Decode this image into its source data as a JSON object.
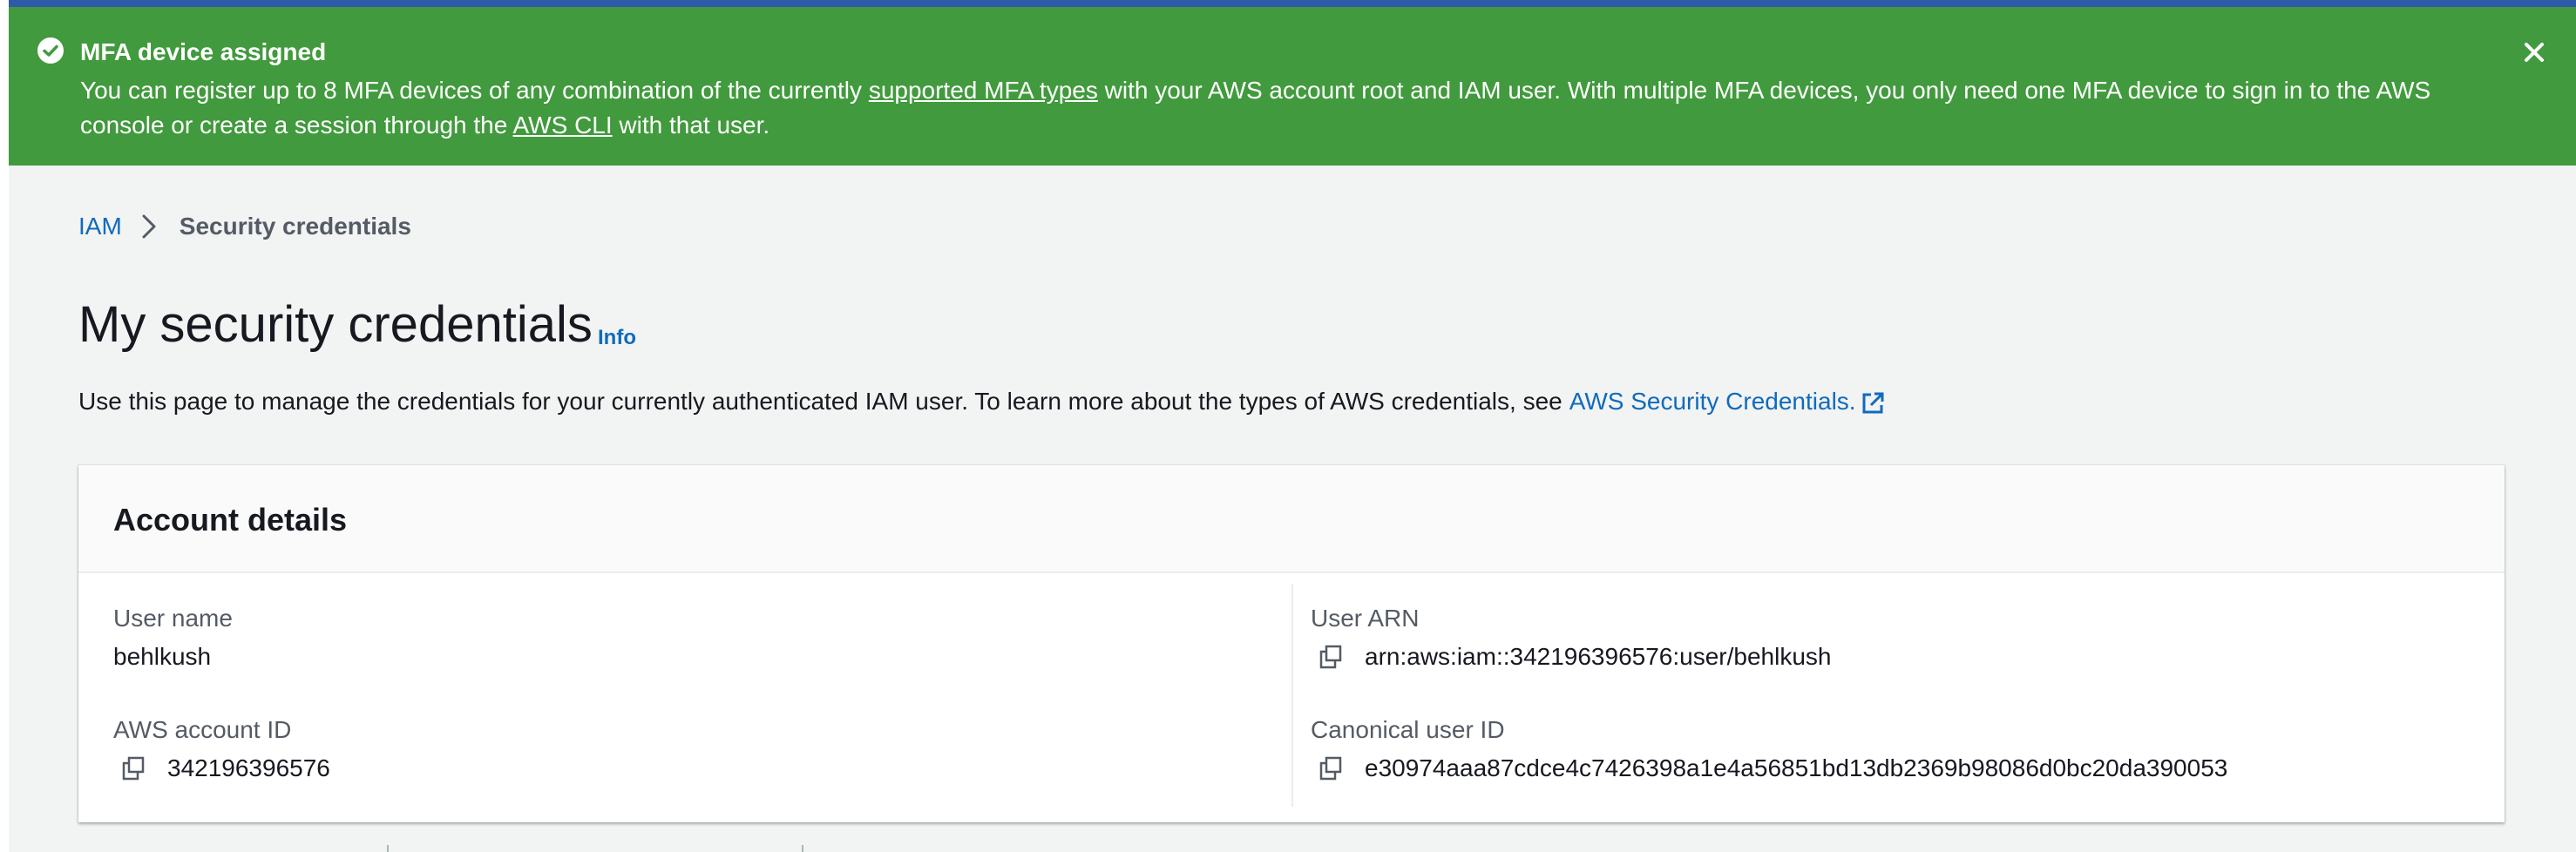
{
  "flash": {
    "status": "success",
    "color": "#419a3d",
    "icon": "check-circle-icon",
    "title": "MFA device assigned",
    "body_part1": "You can register up to 8 MFA devices of any combination of the currently ",
    "link_mfa_types": "supported MFA types",
    "body_part2": " with your AWS account root and IAM user. With multiple MFA devices, you only need one MFA device to sign in to the AWS console or create a session through the ",
    "link_aws_cli": "AWS CLI",
    "body_part3": " with that user.",
    "close_icon": "close-icon"
  },
  "breadcrumb": {
    "root": "IAM",
    "current": "Security credentials"
  },
  "page": {
    "title": "My security credentials",
    "info_link": "Info",
    "intro": "Use this page to manage the credentials for your currently authenticated IAM user. To learn more about the types of AWS credentials, see",
    "intro_link": "AWS Security Credentials."
  },
  "account_details": {
    "title": "Account details",
    "user_name_label": "User name",
    "user_name": "behlkush",
    "account_id_label": "AWS account ID",
    "account_id": "342196396576",
    "user_arn_label": "User ARN",
    "user_arn": "arn:aws:iam::342196396576:user/behlkush",
    "canonical_id_label": "Canonical user ID",
    "canonical_id": "e30974aaa87cdce4c7426398a1e4a56851bd13db2369b98086d0bc20da390053"
  },
  "colors": {
    "link": "#0f6bbd",
    "background": "#f2f3f3",
    "top_strip": "#2f5aa8"
  }
}
